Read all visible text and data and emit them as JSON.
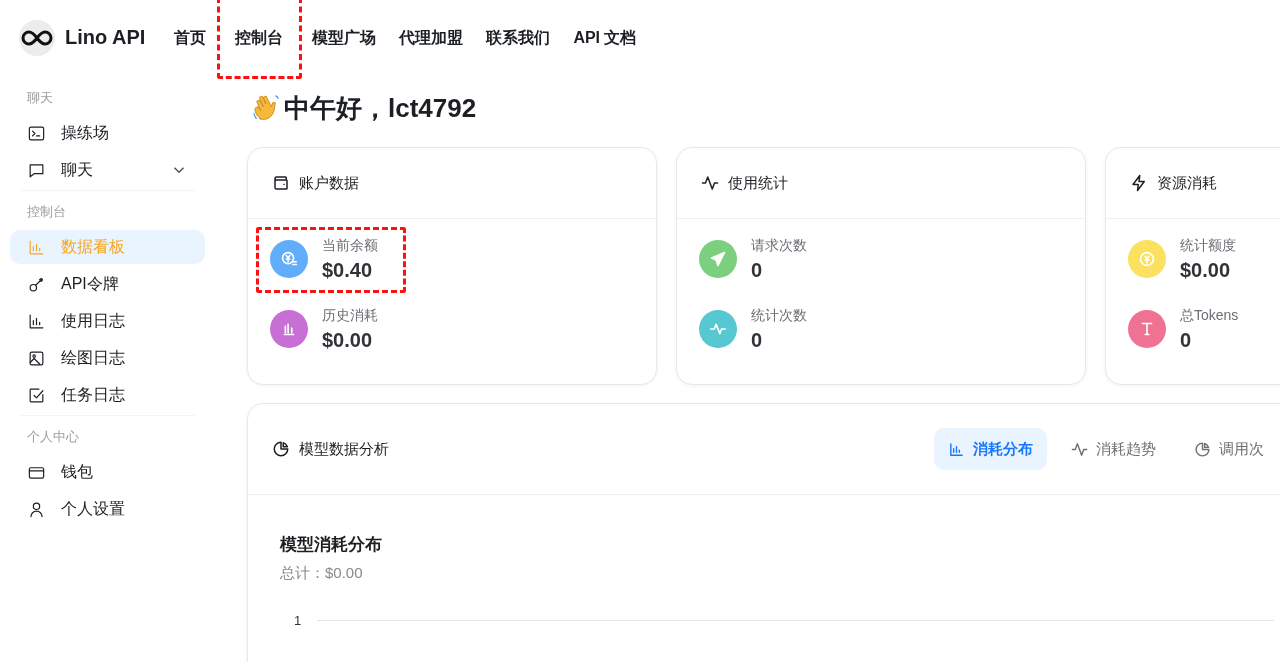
{
  "header": {
    "brand": "Lino API",
    "nav": [
      {
        "label": "首页",
        "annotated": false
      },
      {
        "label": "控制台",
        "annotated": true
      },
      {
        "label": "模型广场",
        "annotated": false
      },
      {
        "label": "代理加盟",
        "annotated": false
      },
      {
        "label": "联系我们",
        "annotated": false
      },
      {
        "label": "API 文档",
        "annotated": false
      }
    ]
  },
  "sidebar": {
    "groups": [
      {
        "label": "聊天",
        "items": [
          {
            "label": "操练场",
            "selected": false
          },
          {
            "label": "聊天",
            "selected": false,
            "expanded": false
          }
        ]
      },
      {
        "label": "控制台",
        "items": [
          {
            "label": "数据看板",
            "selected": true
          },
          {
            "label": "API令牌",
            "selected": false
          },
          {
            "label": "使用日志",
            "selected": false
          },
          {
            "label": "绘图日志",
            "selected": false
          },
          {
            "label": "任务日志",
            "selected": false
          }
        ]
      },
      {
        "label": "个人中心",
        "items": [
          {
            "label": "钱包",
            "selected": false
          },
          {
            "label": "个人设置",
            "selected": false
          }
        ]
      }
    ]
  },
  "greeting": "中午好，lct4792",
  "stat_cards": [
    {
      "title": "账户数据",
      "stats": [
        {
          "label": "当前余额",
          "value": "$0.40",
          "color": "#60aefb",
          "annotated": true
        },
        {
          "label": "历史消耗",
          "value": "$0.00",
          "color": "#c86fd6",
          "annotated": false
        }
      ]
    },
    {
      "title": "使用统计",
      "stats": [
        {
          "label": "请求次数",
          "value": "0",
          "color": "#7bcf7f",
          "annotated": false
        },
        {
          "label": "统计次数",
          "value": "0",
          "color": "#57c8d2",
          "annotated": false
        }
      ]
    },
    {
      "title": "资源消耗",
      "stats": [
        {
          "label": "统计额度",
          "value": "$0.00",
          "color": "#fbe15f",
          "annotated": false
        },
        {
          "label": "总Tokens",
          "value": "0",
          "color": "#f07292",
          "annotated": false
        }
      ]
    }
  ],
  "analysis": {
    "title": "模型数据分析",
    "tabs": [
      {
        "label": "消耗分布",
        "selected": true
      },
      {
        "label": "消耗趋势",
        "selected": false
      },
      {
        "label": "调用次",
        "selected": false
      }
    ],
    "chart_title": "模型消耗分布",
    "chart_total": "总计：$0.00",
    "axis_tick": "1"
  }
}
